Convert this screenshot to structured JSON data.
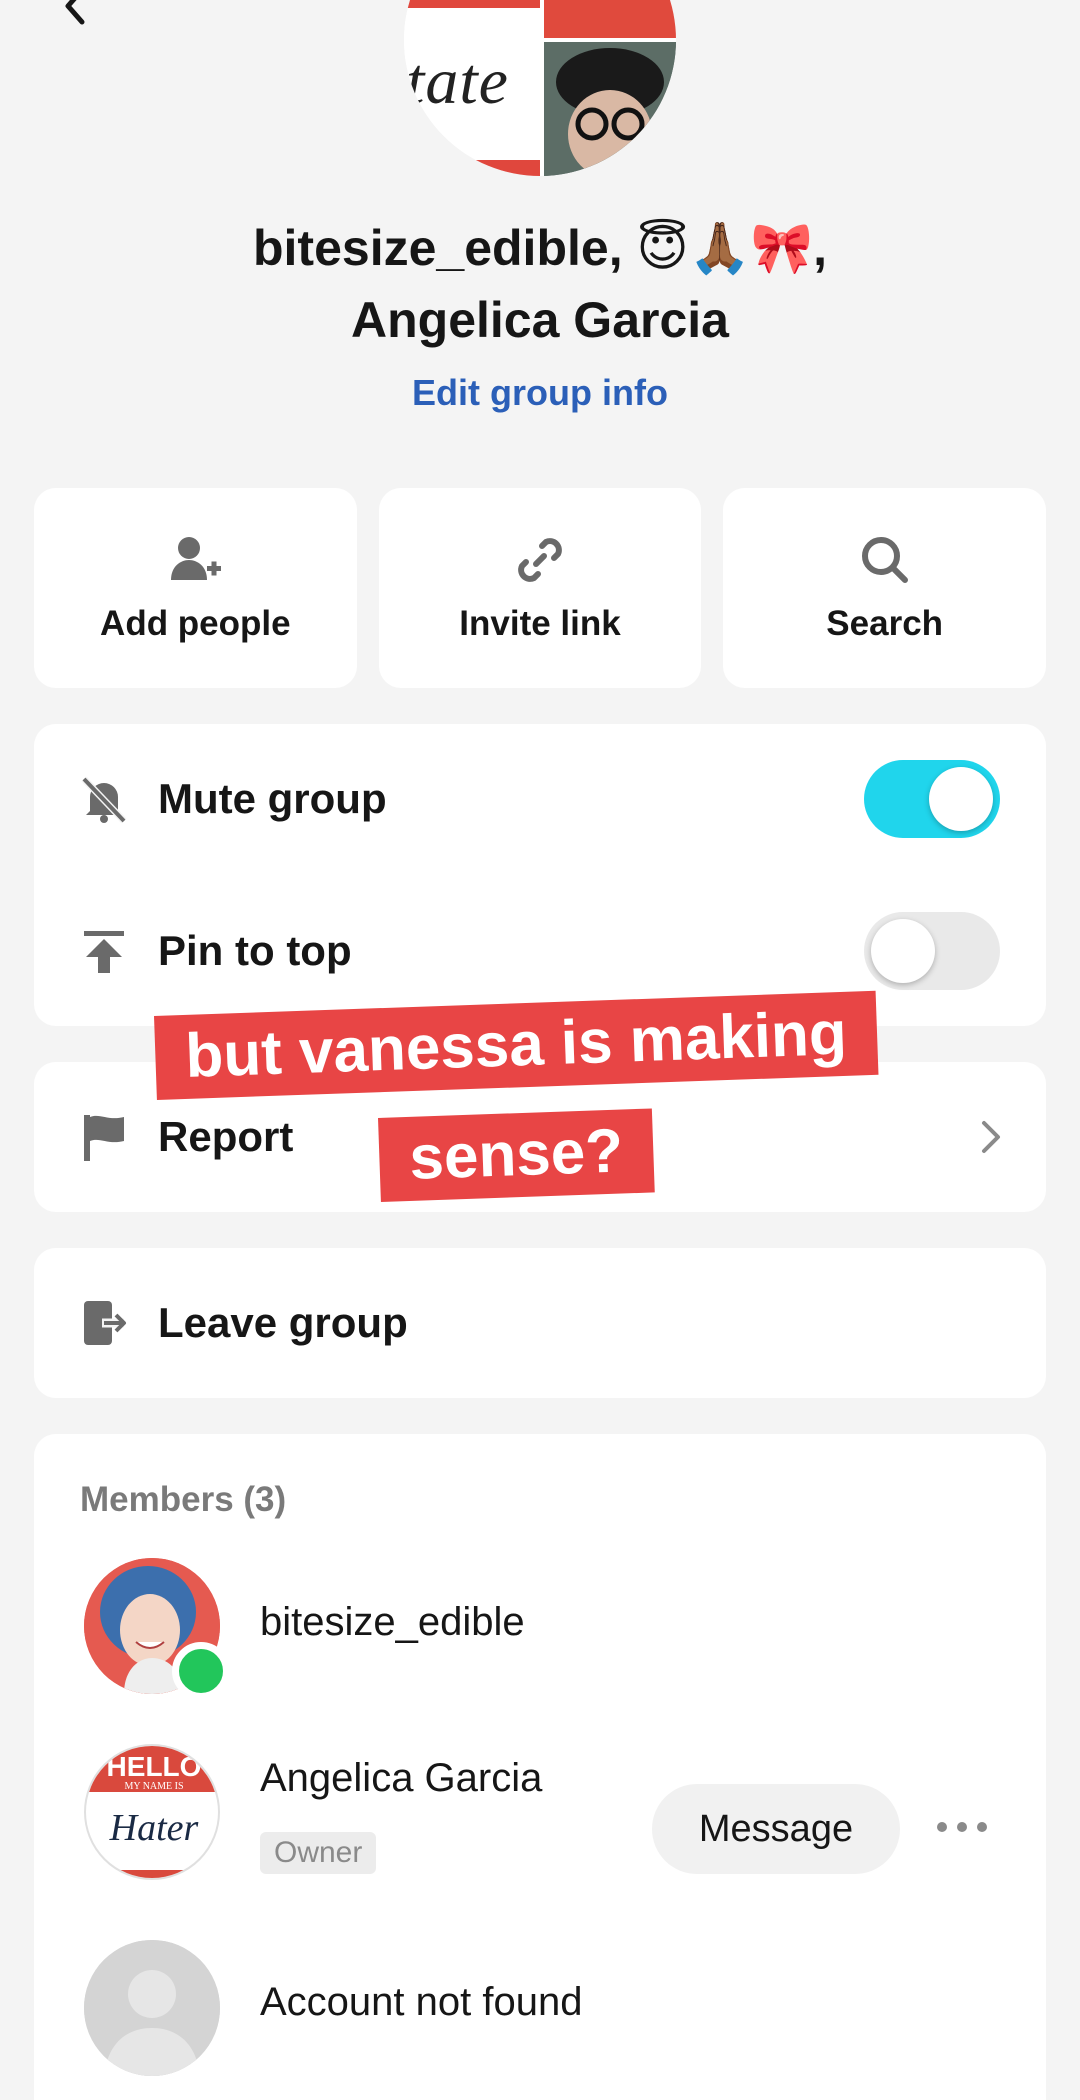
{
  "header": {
    "group_title_line1": "bitesize_edible, 😇🙏🏾🎀,",
    "group_title_line2": "Angelica Garcia",
    "group_avatar_text": "tate",
    "edit_group_info": "Edit group info"
  },
  "actions": [
    {
      "label": "Add people",
      "icon": "add-person-icon"
    },
    {
      "label": "Invite link",
      "icon": "link-icon"
    },
    {
      "label": "Search",
      "icon": "search-icon"
    }
  ],
  "settings": {
    "mute": {
      "label": "Mute group",
      "icon": "bell-off-icon",
      "toggle_on": true
    },
    "pin": {
      "label": "Pin to top",
      "icon": "pin-top-icon",
      "toggle_on": false
    }
  },
  "report": {
    "label": "Report",
    "icon": "flag-icon"
  },
  "leave": {
    "label": "Leave group",
    "icon": "exit-icon"
  },
  "caption": {
    "line1": "but vanessa is making",
    "line2": "sense?"
  },
  "members": {
    "header": "Members (3)",
    "list": [
      {
        "name": "bitesize_edible",
        "online": true
      },
      {
        "name": "Angelica Garcia",
        "badge": "Owner",
        "avatar_text_top": "HELLO",
        "avatar_text_mid": "MY NAME IS",
        "avatar_text_bottom": "Hater",
        "action": "Message"
      },
      {
        "name": "Account not found"
      }
    ]
  },
  "colors": {
    "accent_cyan": "#20d5ec",
    "link_blue": "#2b5fb8",
    "caption_red": "#e84545",
    "online_green": "#22c65b"
  }
}
